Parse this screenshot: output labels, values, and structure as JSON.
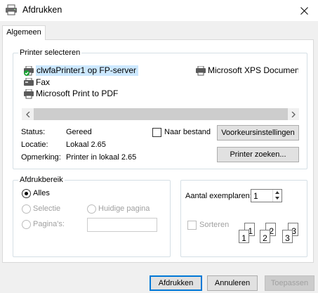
{
  "window": {
    "title": "Afdrukken"
  },
  "tabs": [
    {
      "label": "Algemeen"
    }
  ],
  "printer_select": {
    "legend": "Printer selecteren",
    "printers": [
      {
        "name": "clwfaPrinter1 op FP-server",
        "icon": "network-printer-icon",
        "selected": true
      },
      {
        "name": "Microsoft XPS Document Writer",
        "icon": "printer-icon"
      },
      {
        "name": "Fax",
        "icon": "fax-icon"
      },
      {
        "name": "Microsoft Print to PDF",
        "icon": "printer-icon"
      }
    ],
    "status_label": "Status:",
    "status_value": "Gereed",
    "location_label": "Locatie:",
    "location_value": "Lokaal 2.65",
    "comment_label": "Opmerking:",
    "comment_value": "Printer in lokaal 2.65",
    "print_to_file_label": "Naar bestand",
    "preferences_button": "Voorkeursinstellingen",
    "find_printer_button": "Printer zoeken..."
  },
  "page_range": {
    "legend": "Afdrukbereik",
    "all": "Alles",
    "selection": "Selectie",
    "current_page": "Huidige pagina",
    "pages": "Pagina's:",
    "selected_option": "Alles"
  },
  "copies": {
    "label": "Aantal exemplaren:",
    "value": "1",
    "collate_label": "Sorteren",
    "collate_page_numbers": [
      "1",
      "1",
      "2",
      "2",
      "3",
      "3"
    ]
  },
  "buttons": {
    "print": "Afdrukken",
    "cancel": "Annuleren",
    "apply": "Toepassen"
  },
  "colors": {
    "accent": "#0078d7",
    "selection": "#cce8ff",
    "status_ok": "#1aa032"
  }
}
